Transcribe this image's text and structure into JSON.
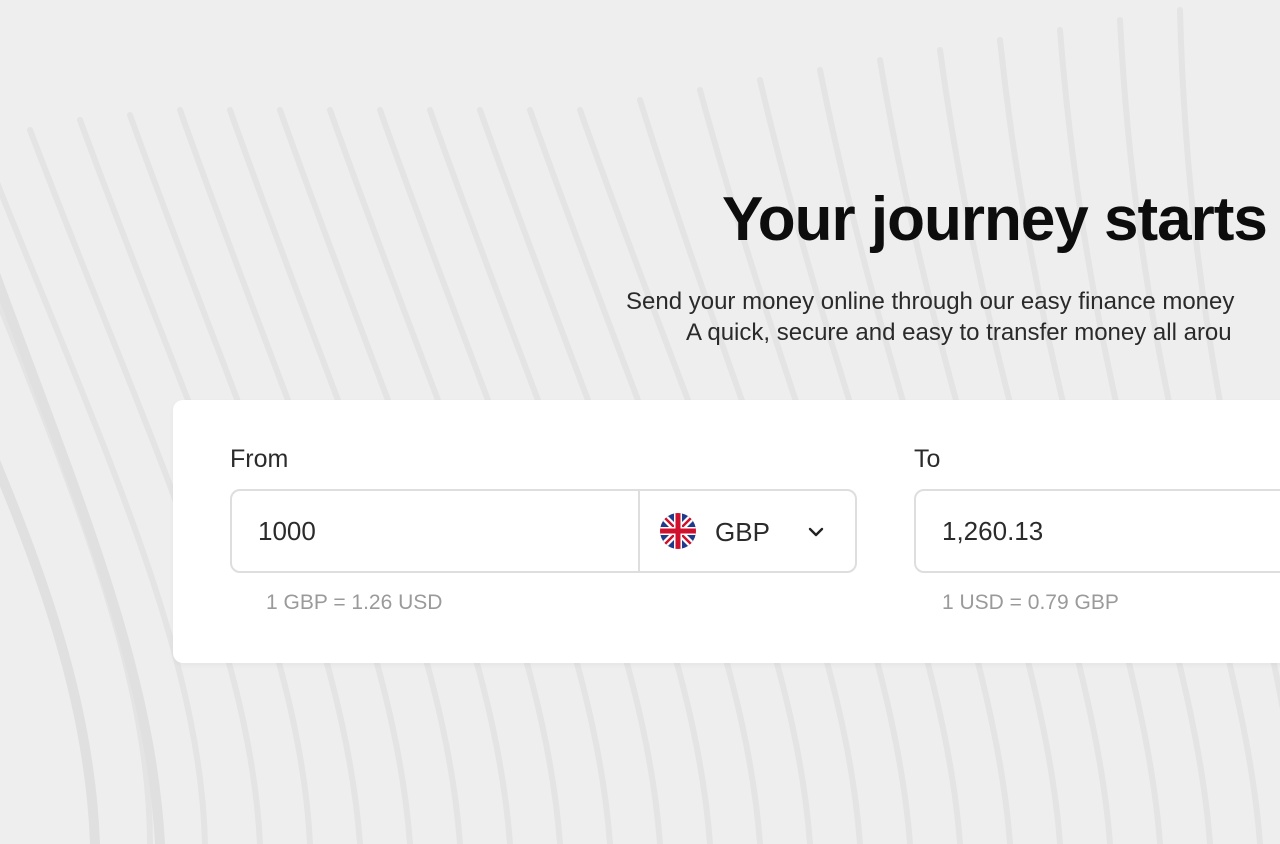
{
  "hero": {
    "headline": "Your journey starts h",
    "subtitle_line1": "Send your money online through our easy finance money",
    "subtitle_line2": "A quick, secure and easy to transfer money all arou"
  },
  "converter": {
    "from": {
      "label": "From",
      "amount": "1000",
      "currency": "GBP",
      "flag_icon": "uk-flag-icon",
      "rate_note": "1 GBP = 1.26 USD"
    },
    "to": {
      "label": "To",
      "amount": "1,260.13",
      "rate_note": "1 USD = 0.79 GBP"
    }
  },
  "colors": {
    "background": "#eeeeee",
    "card": "#ffffff",
    "border": "#dedede",
    "muted_text": "#9a9a9a"
  }
}
